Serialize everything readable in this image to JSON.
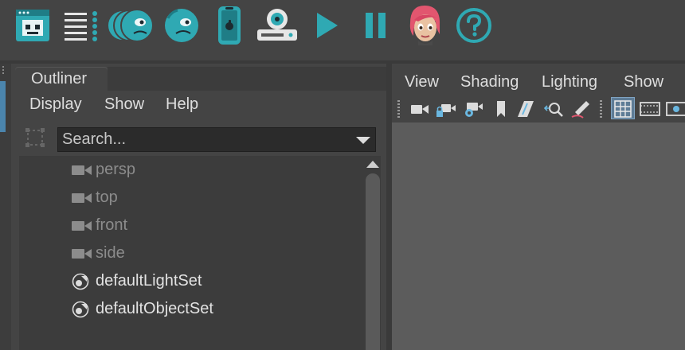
{
  "shelf": {
    "icons": [
      "display-layer-icon",
      "list-menu-icon",
      "multi-faces-icon",
      "face-icon",
      "phone-icon",
      "drive-icon",
      "play-icon",
      "pause-icon",
      "character-avatar",
      "help-icon"
    ],
    "accent_color": "#2fa9b3"
  },
  "outliner": {
    "tab_label": "Outliner",
    "menu": [
      "Display",
      "Show",
      "Help"
    ],
    "search": {
      "placeholder": "Search...",
      "value": ""
    },
    "items": [
      {
        "label": "persp",
        "icon": "camera-icon"
      },
      {
        "label": "top",
        "icon": "camera-icon"
      },
      {
        "label": "front",
        "icon": "camera-icon"
      },
      {
        "label": "side",
        "icon": "camera-icon"
      },
      {
        "label": "defaultLightSet",
        "icon": "set-icon"
      },
      {
        "label": "defaultObjectSet",
        "icon": "set-icon"
      }
    ]
  },
  "viewport": {
    "menu": [
      "View",
      "Shading",
      "Lighting",
      "Show"
    ],
    "toolbar": [
      "camera-icon",
      "lock-camera-icon",
      "camera-attributes-icon",
      "bookmark-icon",
      "image-plane-icon",
      "pan-zoom-icon",
      "grease-pencil-icon",
      "grid-icon",
      "film-gate-icon",
      "resolution-gate-icon"
    ],
    "active_tool": "grid-icon"
  }
}
